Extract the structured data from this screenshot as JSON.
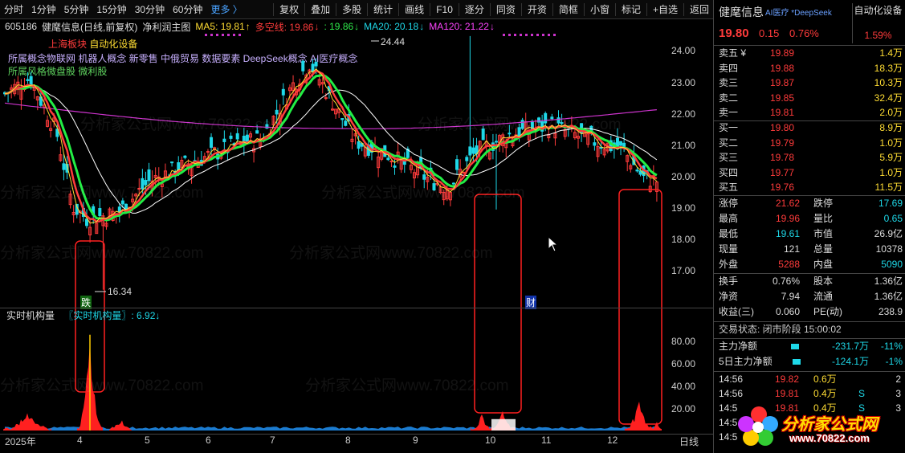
{
  "toolbar": {
    "left": [
      "分时",
      "1分钟",
      "5分钟",
      "15分钟",
      "30分钟",
      "60分钟",
      "更多 〉"
    ],
    "right": [
      "复权",
      "叠加",
      "多股",
      "统计",
      "画线",
      "F10",
      "逐分",
      "同资",
      "开资",
      "简框",
      "小窗",
      "标记",
      "+自选",
      "返回"
    ]
  },
  "header": {
    "code": "605186",
    "name": "健麾信息(日线,前复权)",
    "indicator": "净利润主图",
    "ma5": "MA5: 19.81",
    "ma5_arrow": "↑",
    "duokong": "多空线: 19.86",
    "duokong_arrow": "↓",
    "extra": ": 19.86",
    "extra_arrow": "↓",
    "ma20": "MA20: 20.18",
    "ma20_arrow": "↓",
    "ma120": "MA120: 21.22",
    "ma120_arrow": "↓"
  },
  "concepts": {
    "line1_label": "上海板块",
    "line1_value": "自动化设备",
    "line2": "所属概念物联网 机器人概念 新零售 中俄贸易 数据要素 DeepSeek概念 AI医疗概念",
    "line3": "所属风格微盘股 微利股"
  },
  "price_axis": [
    "24.00",
    "23.00",
    "22.00",
    "21.00",
    "20.00",
    "19.00",
    "18.00",
    "17.00"
  ],
  "annotations": {
    "high": "24.44",
    "low": "16.34",
    "die": "跌",
    "cai": "财",
    "watermark": "分析家公式网www.70822.com"
  },
  "sub_indicator": {
    "name": "实时机构量",
    "formula": "〖实时机构量〗: 6.92",
    "arrow": "↓",
    "axis": [
      "80.00",
      "60.00",
      "40.00",
      "20.00"
    ]
  },
  "x_axis": {
    "year": "2025年",
    "months": [
      "4",
      "5",
      "6",
      "7",
      "8",
      "9",
      "10",
      "11",
      "12"
    ],
    "period": "日线"
  },
  "right_panel": {
    "title": "健麾信息",
    "tags": "AI医疗 *DeepSeek",
    "sector": "自动化设备",
    "sector_pct": "1.59%",
    "price": "19.80",
    "change": "0.15",
    "change_pct": "0.76%",
    "asks": [
      {
        "label": "卖五 ¥",
        "price": "19.89",
        "vol": "1.4万"
      },
      {
        "label": "卖四",
        "price": "19.88",
        "vol": "18.3万"
      },
      {
        "label": "卖三",
        "price": "19.87",
        "vol": "10.3万"
      },
      {
        "label": "卖二",
        "price": "19.85",
        "vol": "32.4万"
      },
      {
        "label": "卖一",
        "price": "19.81",
        "vol": "2.0万"
      }
    ],
    "bids": [
      {
        "label": "买一",
        "price": "19.80",
        "vol": "8.9万"
      },
      {
        "label": "买二",
        "price": "19.79",
        "vol": "1.0万"
      },
      {
        "label": "买三",
        "price": "19.78",
        "vol": "5.9万"
      },
      {
        "label": "买四",
        "price": "19.77",
        "vol": "1.0万"
      },
      {
        "label": "买五",
        "price": "19.76",
        "vol": "11.5万"
      }
    ],
    "stats": [
      {
        "l1": "涨停",
        "v1": "21.62",
        "c1": "red",
        "l2": "跌停",
        "v2": "17.69",
        "c2": "cyan"
      },
      {
        "l1": "最高",
        "v1": "19.96",
        "c1": "red",
        "l2": "量比",
        "v2": "0.65",
        "c2": "cyan"
      },
      {
        "l1": "最低",
        "v1": "19.61",
        "c1": "cyan",
        "l2": "市值",
        "v2": "26.9亿",
        "c2": "white"
      },
      {
        "l1": "现量",
        "v1": "121",
        "c1": "white",
        "l2": "总量",
        "v2": "10378",
        "c2": "white"
      },
      {
        "l1": "外盘",
        "v1": "5288",
        "c1": "red",
        "l2": "内盘",
        "v2": "5090",
        "c2": "cyan"
      }
    ],
    "stats2": [
      {
        "l1": "换手",
        "v1": "0.76%",
        "l2": "股本",
        "v2": "1.36亿"
      },
      {
        "l1": "净资",
        "v1": "7.94",
        "l2": "流通",
        "v2": "1.36亿"
      },
      {
        "l1": "收益(三)",
        "v1": "0.060",
        "l2": "PE(动)",
        "v2": "238.9"
      }
    ],
    "trade_status": "交易状态: 闭市阶段 15:00:02",
    "flows": [
      {
        "label": "主力净额",
        "amount": "-231.7万",
        "pct": "-11%"
      },
      {
        "label": "5日主力净额",
        "amount": "-124.1万",
        "pct": "-1%"
      }
    ],
    "ticks": [
      {
        "time": "14:56",
        "price": "19.82",
        "vol": "0.6万",
        "flag": "",
        "n": "2"
      },
      {
        "time": "14:56",
        "price": "19.81",
        "vol": "0.4万",
        "flag": "S",
        "n": "3"
      },
      {
        "time": "14:5",
        "price": "19.81",
        "vol": "0.4万",
        "flag": "S",
        "n": "3"
      },
      {
        "time": "14:5",
        "price": "",
        "vol": "",
        "flag": "",
        "n": ""
      },
      {
        "time": "14:5",
        "price": "",
        "vol": "",
        "flag": "",
        "n": ""
      }
    ],
    "logo_main": "分析家公式网",
    "logo_url": "www.70822.com"
  },
  "colors": {
    "up": "#ff3b3b",
    "down": "#1ed8e8",
    "ma5": "#ffffff",
    "ma10": "#ffdd33",
    "ma20": "#22ee44",
    "ma120": "#cc33cc",
    "box": "#ff2020"
  }
}
